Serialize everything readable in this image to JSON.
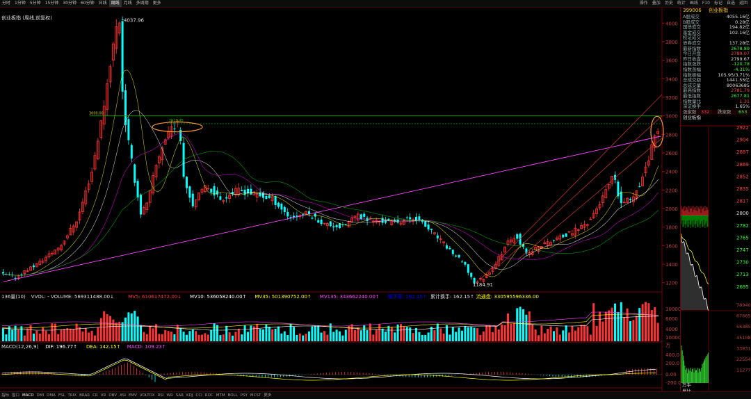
{
  "toolbar": {
    "tabs": [
      "分时",
      "1分钟",
      "5分钟",
      "15分钟",
      "30分钟",
      "60分钟",
      "日线",
      "周线",
      "月线",
      "多周期",
      "更多"
    ],
    "active_tab": "周线",
    "right_buttons": [
      "操作",
      "叠加",
      "历史",
      "统计",
      "画线",
      "F10",
      "标记",
      "自选",
      "返回"
    ]
  },
  "chart": {
    "title": "创业板指 (周线,前复权)",
    "price_ticks": [
      "4000",
      "3800",
      "3600",
      "3400",
      "3200",
      "3000",
      "2800",
      "2600",
      "2400",
      "2200",
      "2000",
      "1800",
      "1600",
      "1400",
      "1200"
    ],
    "high_label": "4037.96",
    "low_label": "1184.91",
    "ref_level_label": "3000.00",
    "peak2_label": "2915.95",
    "colors": {
      "up": "#ff3333",
      "down": "#00ffff",
      "ma_white": "#ffffff",
      "ma_yellow": "#ffff00",
      "ma_magenta": "#ff00ff",
      "ma_green": "#00cc00",
      "trend_magenta": "#ff44ff",
      "trend_red": "#c03030",
      "highlight": "#ff9933"
    }
  },
  "volume": {
    "header": [
      "136量(10)",
      "VVOL: - VOLUME: 569311488.00↓",
      "MV5: 610617472.00↓",
      "MV10: 536058240.00↑",
      "MV35: 501390752.00↑",
      "MV135: 343662240.00↑",
      "换手率: 162.15↑",
      "累计换手: 162.15↑",
      "流通盘: 330595596336.00"
    ],
    "ticks": [
      "10000",
      "6000",
      "4000",
      "10000"
    ],
    "unit": "万"
  },
  "macd": {
    "header": [
      "MACD(12,26,9)",
      "DIF: 196.77↑",
      "DEA: 142.15↑",
      "MACD: 109.23↑"
    ],
    "ticks": [
      "400.0",
      "200.0",
      "0.00",
      "-200.0"
    ]
  },
  "sidepanel": {
    "code": "399006",
    "name": "创业板指",
    "rows": [
      {
        "l": "A股成交",
        "v": "4055.16亿",
        "c": "#dddddd"
      },
      {
        "l": "B股成交",
        "v": "0.28亿",
        "c": "#dddddd"
      },
      {
        "l": "国债成交",
        "v": "194.82亿",
        "c": "#dddddd"
      },
      {
        "l": "基金成交",
        "v": "102.16亿",
        "c": "#dddddd"
      },
      {
        "l": "权证成交",
        "v": "",
        "c": "#dddddd"
      },
      {
        "l": "债券成交",
        "v": "137.28亿",
        "c": "#dddddd"
      },
      {
        "l": "最新指数",
        "v": "2678.89",
        "c": "#33ff33"
      },
      {
        "l": "今日开盘",
        "v": "2789.07",
        "c": "#ff4444"
      },
      {
        "l": "昨日收盘",
        "v": "2799.67",
        "c": "#dddddd"
      },
      {
        "l": "指数涨跌",
        "v": "-120.78",
        "c": "#33ff33"
      },
      {
        "l": "指数涨幅",
        "v": "-4.31%",
        "c": "#33ff33"
      },
      {
        "l": "指数振幅",
        "v": "105.95/3.71%",
        "c": "#dddddd"
      },
      {
        "l": "总成交额",
        "v": "1441.55亿",
        "c": "#dddddd"
      },
      {
        "l": "总成交量",
        "v": "80063685",
        "c": "#dddddd"
      },
      {
        "l": "最高指数",
        "v": "2781.79",
        "c": "#ff4444"
      },
      {
        "l": "最低指数",
        "v": "2677.81",
        "c": "#33ff33"
      },
      {
        "l": "指数量比",
        "v": "1.31",
        "c": "#ff4444"
      },
      {
        "l": "深证换手",
        "v": "1.65%",
        "c": "#dddddd"
      }
    ],
    "up_label": "涨家数",
    "up_value": "332",
    "down_label": "跌家数",
    "down_value": "653",
    "mini_title": "创业板指",
    "mini_ticks": [
      "2922",
      "2904",
      "2887",
      "2869",
      "2852",
      "2835",
      "2817",
      "2800",
      "2782",
      "2765",
      "2747",
      "2730",
      "2713",
      "2695"
    ],
    "mini_vol_ticks": [
      "78940",
      "67665",
      "56385",
      "45108",
      "33831",
      "22554",
      "11277"
    ],
    "mini_vol_unit": "万手",
    "mini_vol_label": "量比"
  },
  "bottombar": {
    "items": [
      "指标",
      "窗口",
      "MACD",
      "DMI",
      "DMA",
      "FSL",
      "TRIX",
      "BRAR",
      "CR",
      "VR",
      "OBV",
      "ASI",
      "EMV",
      "VOLTDX",
      "RSI",
      "WR",
      "SAR",
      "KDJ",
      "CCI",
      "ROC",
      "MTM",
      "BOLL",
      "PSY",
      "MCST",
      "更多"
    ],
    "active": "MACD",
    "right": "更多"
  }
}
